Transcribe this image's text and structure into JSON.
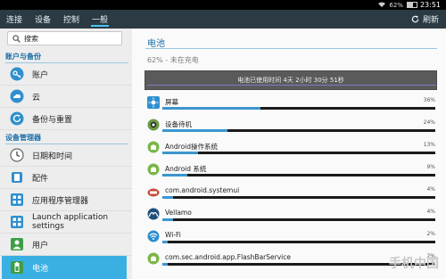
{
  "statusbar": {
    "battery_pct": "62%",
    "time": "23:51"
  },
  "tabs": [
    {
      "label": "连接"
    },
    {
      "label": "设备"
    },
    {
      "label": "控制"
    },
    {
      "label": "一般",
      "active": true
    }
  ],
  "refresh_label": "刷新",
  "search": {
    "placeholder": "搜索"
  },
  "sidebar": {
    "sections": [
      {
        "title": "账户与备份",
        "items": [
          "账户",
          "云",
          "备份与重置"
        ]
      },
      {
        "title": "设备管理器",
        "items": [
          "日期和时间",
          "配件",
          "应用程序管理器",
          "Launch application settings",
          "用户",
          "电池"
        ]
      }
    ],
    "active_item": "电池"
  },
  "main": {
    "title": "电池",
    "status": "62% - 未在充电",
    "graph_text": "电池已使用时间 4天 2小时 30分 51秒",
    "items": [
      {
        "name": "屏幕",
        "pct": "36%",
        "value": 0.36
      },
      {
        "name": "设备待机",
        "pct": "24%",
        "value": 0.24
      },
      {
        "name": "Android操作系统",
        "pct": "13%",
        "value": 0.13
      },
      {
        "name": "Android 系统",
        "pct": "9%",
        "value": 0.09
      },
      {
        "name": "com.android.systemui",
        "pct": "4%",
        "value": 0.04
      },
      {
        "name": "Vellamo",
        "pct": "4%",
        "value": 0.04
      },
      {
        "name": "Wi-Fi",
        "pct": "2%",
        "value": 0.02
      },
      {
        "name": "com.sec.android.app.FlashBarService",
        "pct": "2%",
        "value": 0.02
      }
    ]
  },
  "watermark": "手机中国"
}
